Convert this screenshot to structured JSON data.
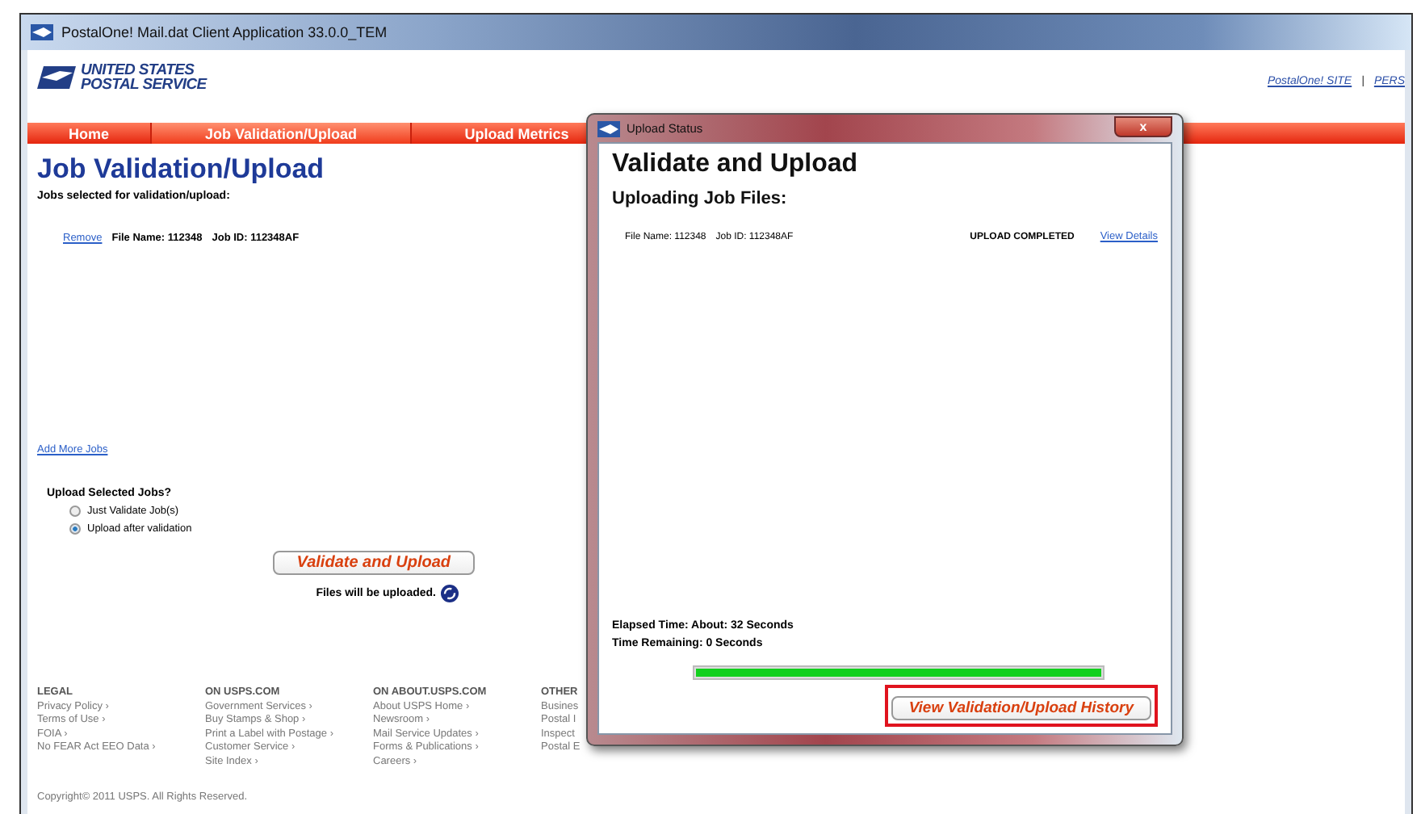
{
  "window": {
    "title": "PostalOne! Mail.dat Client Application 33.0.0_TEM"
  },
  "logo": {
    "line_1": "UNITED STATES",
    "line_2": "POSTAL SERVICE"
  },
  "header_links": [
    "PostalOne! SITE",
    "|",
    "PERS"
  ],
  "nav": [
    {
      "label": "Home",
      "selected": false
    },
    {
      "label": "Job Validation/Upload",
      "selected": true
    },
    {
      "label": "Upload Metrics",
      "selected": false
    }
  ],
  "page": {
    "title": "Job Validation/Upload",
    "subtitle": "Jobs selected for validation/upload:",
    "jobs": [
      {
        "action": "Remove",
        "file_name": "File Name: 112348",
        "job_id": "Job ID: 112348AF"
      }
    ],
    "add_link": "Add More Jobs",
    "question": "Upload Selected Jobs?",
    "options": [
      {
        "label": "Just Validate Job(s)",
        "selected": false
      },
      {
        "label": "Upload after validation",
        "selected": true
      }
    ],
    "button": "Validate and Upload",
    "note": "Files will be uploaded."
  },
  "footer": {
    "columns": [
      {
        "heading": "LEGAL",
        "links": [
          "Privacy Policy ›",
          "Terms of Use ›",
          "FOIA ›",
          "No FEAR Act EEO Data ›"
        ]
      },
      {
        "heading": "ON USPS.COM",
        "links": [
          "Government Services ›",
          "Buy Stamps & Shop ›",
          "Print a Label with Postage ›",
          "Customer Service ›",
          "Site Index ›"
        ]
      },
      {
        "heading": "ON ABOUT.USPS.COM",
        "links": [
          "About USPS Home ›",
          "Newsroom ›",
          "Mail Service Updates ›",
          "Forms & Publications ›",
          "Careers ›"
        ]
      },
      {
        "heading": "OTHER",
        "links": [
          "Busines",
          "Postal I",
          "Inspect",
          "Postal E"
        ]
      }
    ],
    "copyright": "Copyright© 2011 USPS. All Rights Reserved."
  },
  "dialog": {
    "title": "Upload Status",
    "close": "x",
    "heading": "Validate and Upload",
    "subheading": "Uploading Job Files:",
    "files": [
      {
        "file_name": "File Name: 112348",
        "job_id": "Job ID: 112348AF",
        "status": "UPLOAD COMPLETED",
        "link": "View Details"
      }
    ],
    "elapsed": "Elapsed Time: About: 32 Seconds",
    "remaining": "Time Remaining: 0 Seconds",
    "progress": {
      "level": 1
    },
    "button": "View Validation/Upload History"
  }
}
